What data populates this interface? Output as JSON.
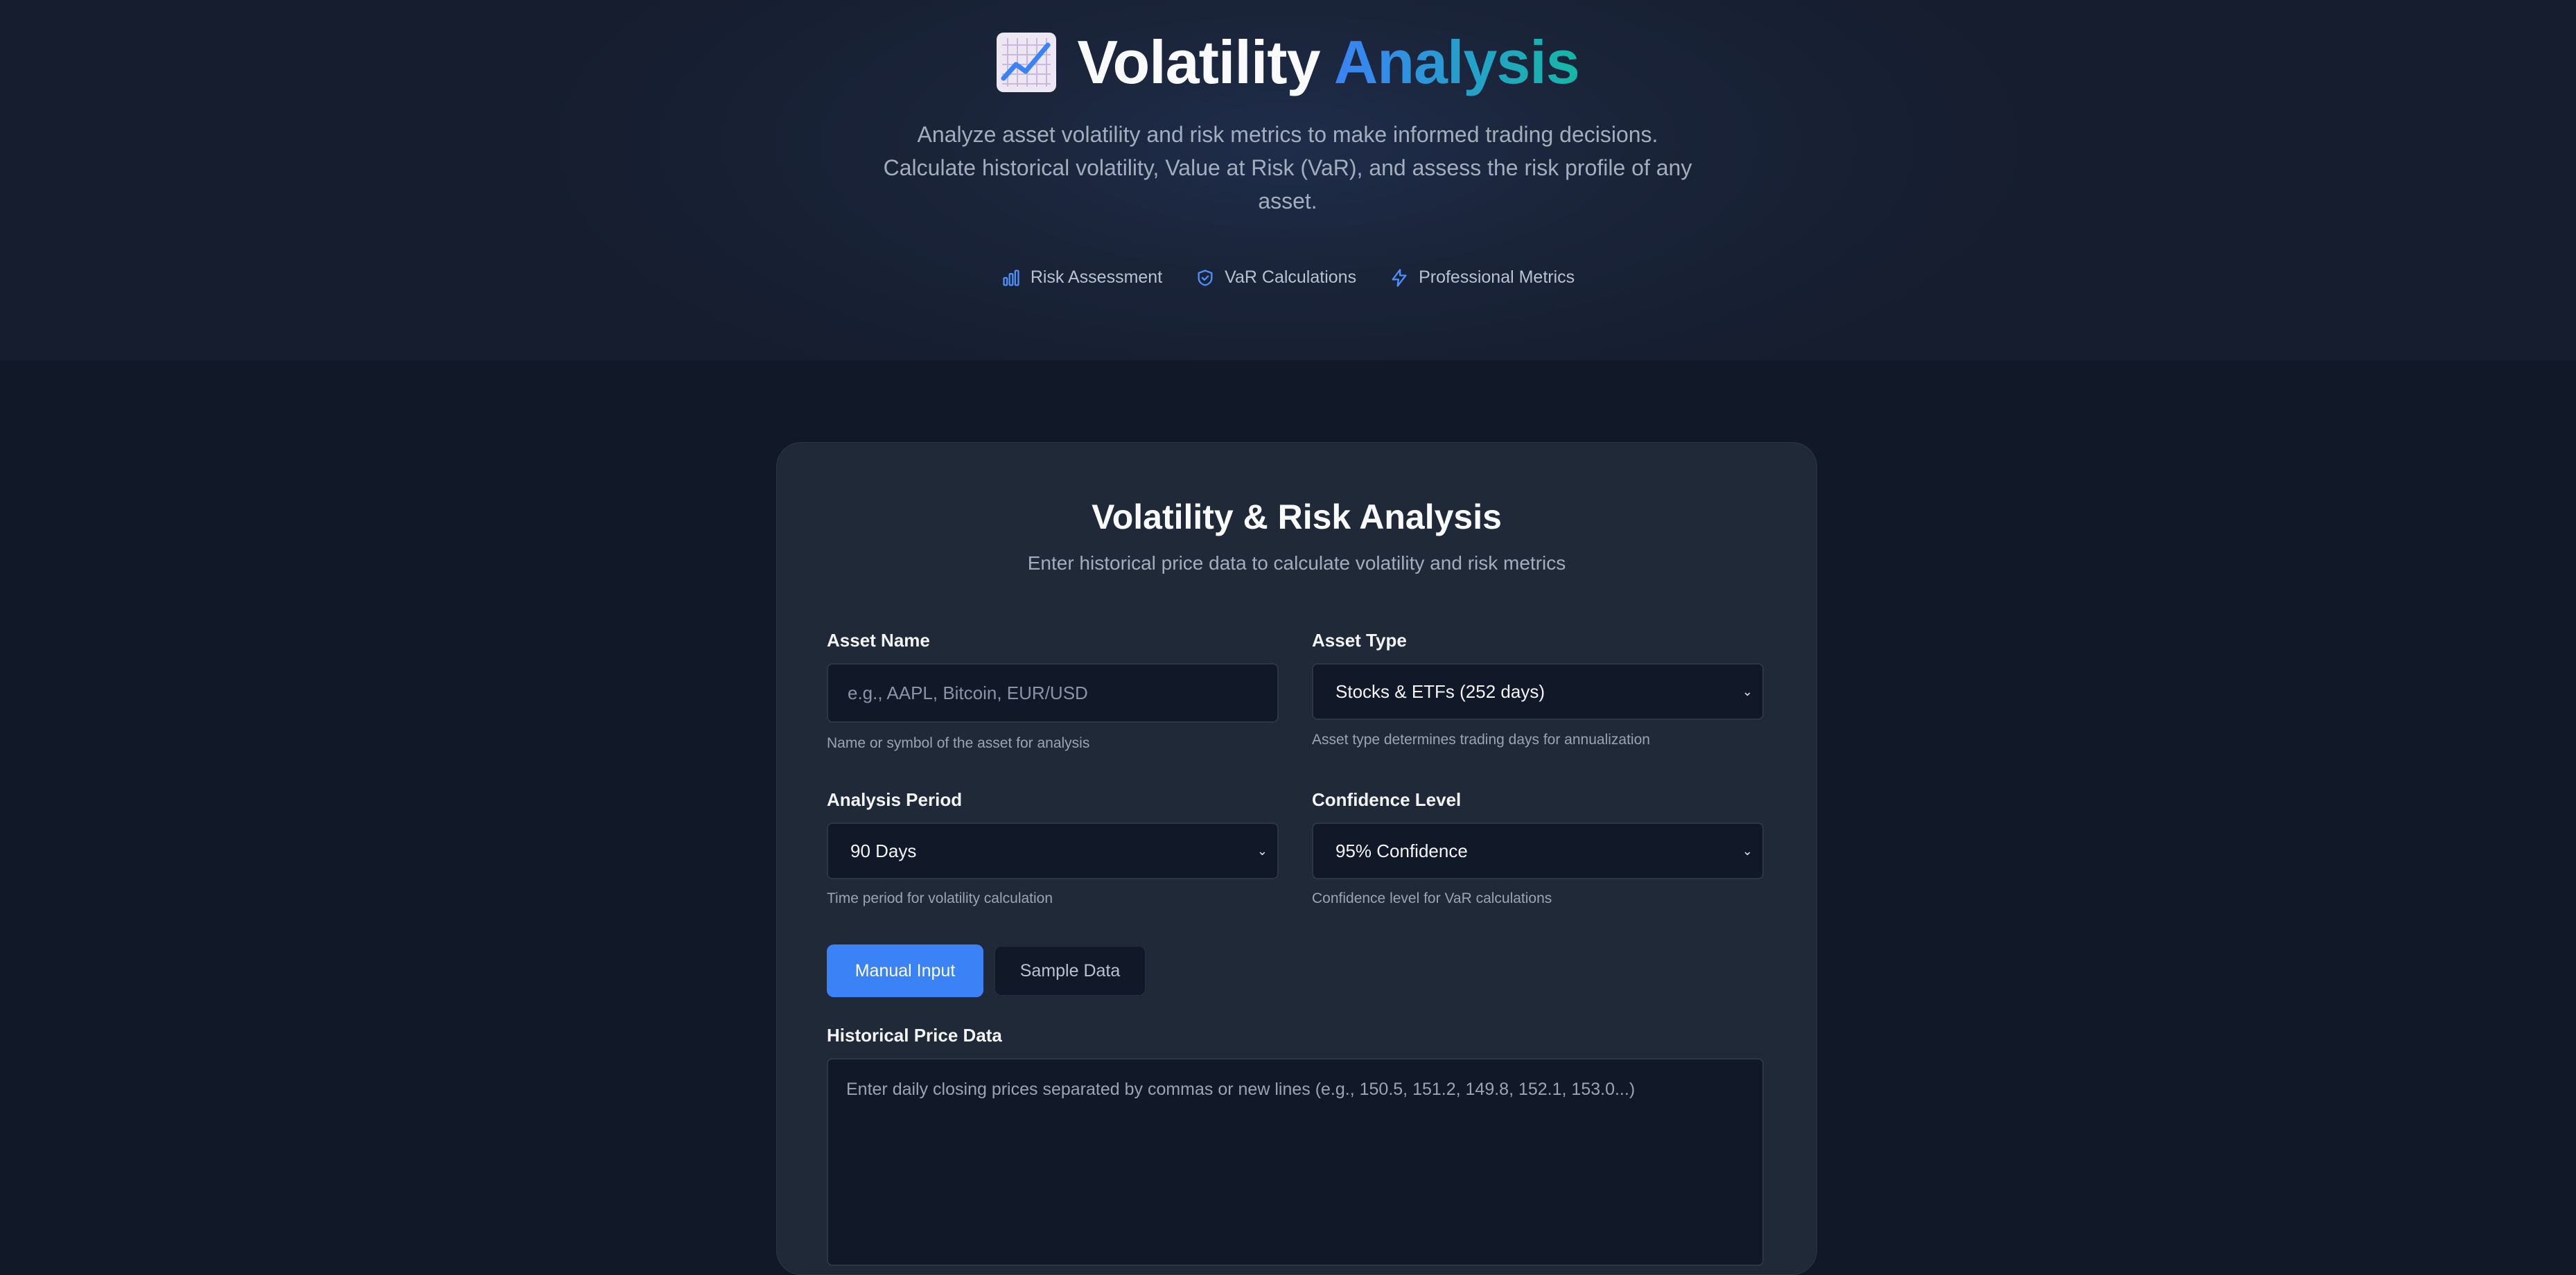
{
  "hero": {
    "icon": "chart-increasing-icon",
    "title_plain": "Volatility",
    "title_accent": "Analysis",
    "subtitle": "Analyze asset volatility and risk metrics to make informed trading decisions. Calculate historical volatility, Value at Risk (VaR), and assess the risk profile of any asset.",
    "features": [
      {
        "icon": "bar-chart-icon",
        "label": "Risk Assessment"
      },
      {
        "icon": "shield-check-icon",
        "label": "VaR Calculations"
      },
      {
        "icon": "lightning-icon",
        "label": "Professional Metrics"
      }
    ]
  },
  "form": {
    "title": "Volatility & Risk Analysis",
    "subtitle": "Enter historical price data to calculate volatility and risk metrics",
    "asset_name": {
      "label": "Asset Name",
      "placeholder": "e.g., AAPL, Bitcoin, EUR/USD",
      "value": "",
      "help": "Name or symbol of the asset for analysis"
    },
    "asset_type": {
      "label": "Asset Type",
      "selected": "Stocks & ETFs (252 days)",
      "help": "Asset type determines trading days for annualization"
    },
    "analysis_period": {
      "label": "Analysis Period",
      "selected": "90 Days",
      "help": "Time period for volatility calculation"
    },
    "confidence_level": {
      "label": "Confidence Level",
      "selected": "95% Confidence",
      "help": "Confidence level for VaR calculations"
    },
    "tabs": {
      "manual": "Manual Input",
      "sample": "Sample Data",
      "active": "manual"
    },
    "price_data": {
      "label": "Historical Price Data",
      "placeholder": "Enter daily closing prices separated by commas or new lines (e.g., 150.5, 151.2, 149.8, 152.1, 153.0...)"
    }
  },
  "colors": {
    "background": "#111827",
    "card": "#1f2937",
    "accent_blue": "#3b82f6",
    "accent_teal": "#14b8a6",
    "input_bg": "#111827"
  }
}
